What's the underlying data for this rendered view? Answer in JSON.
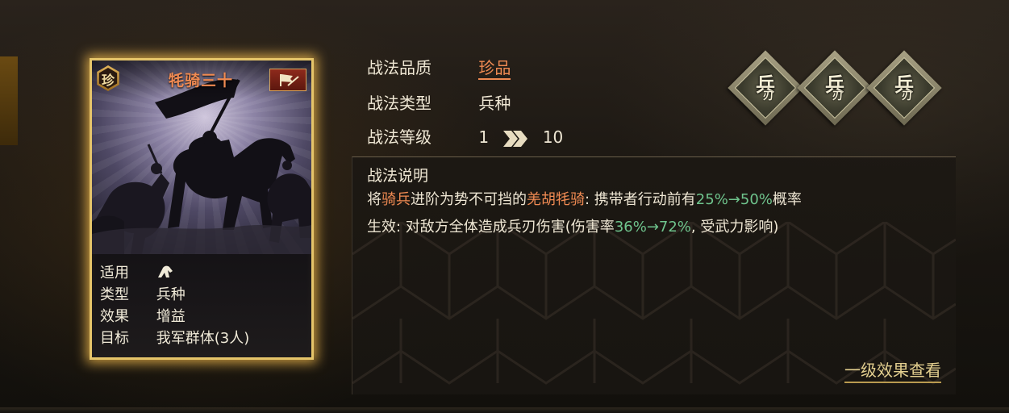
{
  "card": {
    "rarity_badge": "珍",
    "title": "牦骑三十",
    "info": [
      {
        "key": "适用",
        "value": ""
      },
      {
        "key": "类型",
        "value": "兵种"
      },
      {
        "key": "效果",
        "value": "增益"
      },
      {
        "key": "目标",
        "value": "我军群体(3人)"
      }
    ]
  },
  "props": {
    "quality_label": "战法品质",
    "quality_value": "珍品",
    "type_label": "战法类型",
    "type_value": "兵种",
    "level_label": "战法等级",
    "level_from": "1",
    "level_to": "10"
  },
  "diamonds": [
    {
      "main": "兵",
      "sub": "刃"
    },
    {
      "main": "兵",
      "sub": "刃"
    },
    {
      "main": "兵",
      "sub": "刃"
    }
  ],
  "description": {
    "title": "战法说明",
    "line1": {
      "p1": "将",
      "h1": "骑兵",
      "p2": "进阶为势不可挡的",
      "h2": "羌胡牦骑",
      "p3": ": 携带者行动前有",
      "g1": "25%→50%",
      "p4": "概率"
    },
    "line2": {
      "p1": "生效: 对敌方全体造成兵刃伤害(伤害率",
      "g1": "36%→72%",
      "p2": ", 受武力影响)"
    },
    "more_link": "一级效果查看"
  },
  "colors": {
    "accent_orange": "#ef8a52",
    "accent_green": "#6fc48d",
    "card_border": "#e6c56a"
  }
}
